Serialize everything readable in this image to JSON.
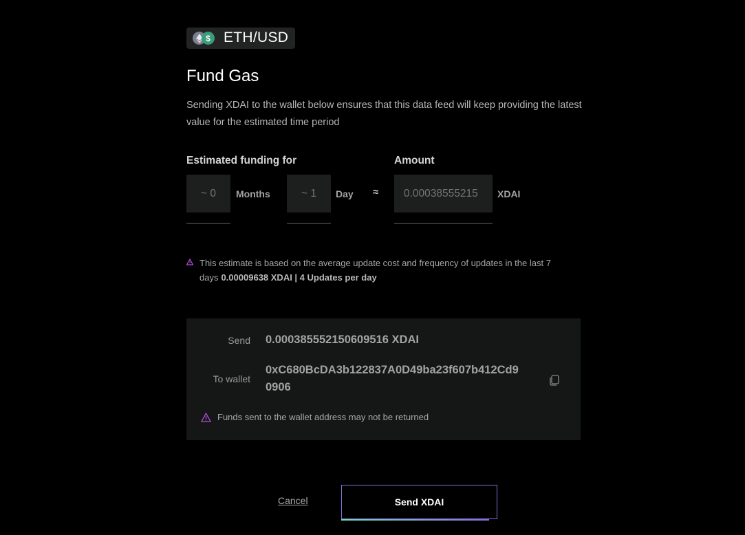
{
  "pair": {
    "label": "ETH/USD",
    "base_icon": "ethereum-icon",
    "quote_icon": "dollar-icon",
    "quote_glyph": "$"
  },
  "title": "Fund Gas",
  "description": "Sending XDAI to the wallet below ensures that this data feed will keep providing the latest value for the estimated time period",
  "funding": {
    "label": "Estimated funding for",
    "months_value": "~ 0",
    "months_unit": "Months",
    "days_value": "~ 1",
    "days_unit": "Day",
    "approx_symbol": "≈"
  },
  "amount": {
    "label": "Amount",
    "value": "0.00038555215",
    "unit": "XDAI"
  },
  "estimate_note": {
    "text": "This estimate is based on the average update cost and frequency of updates in the last 7 days",
    "stats": "0.00009638 XDAI | 4 Updates per day"
  },
  "send_card": {
    "send_label": "Send",
    "send_value": "0.000385552150609516 XDAI",
    "wallet_label": "To wallet",
    "wallet_line1": "0xC680BcDA3b122837A0D49ba23f607b412Cd9",
    "wallet_line2": "0906",
    "warning": "Funds sent to the wallet address may not be returned"
  },
  "actions": {
    "cancel_label": "Cancel",
    "send_label": "Send XDAI"
  },
  "colors": {
    "background": "#000000",
    "accent_border": "#8a6fd8",
    "warning_icon": "#b44fd8",
    "card_background": "#151616"
  }
}
